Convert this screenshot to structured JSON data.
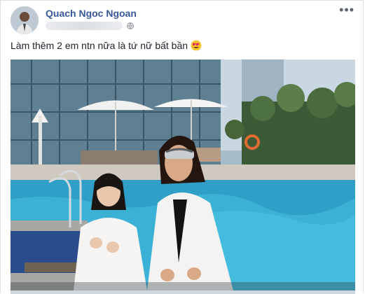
{
  "post": {
    "author_name": "Quach Ngoc Ngoan",
    "caption": "Làm thêm 2 em ntn nữa là tứ nữ bất bần",
    "caption_emoji": "heart-eyes-emoji",
    "more_label": "•••",
    "privacy_icon": "globe-icon",
    "accent_color": "#385898"
  }
}
